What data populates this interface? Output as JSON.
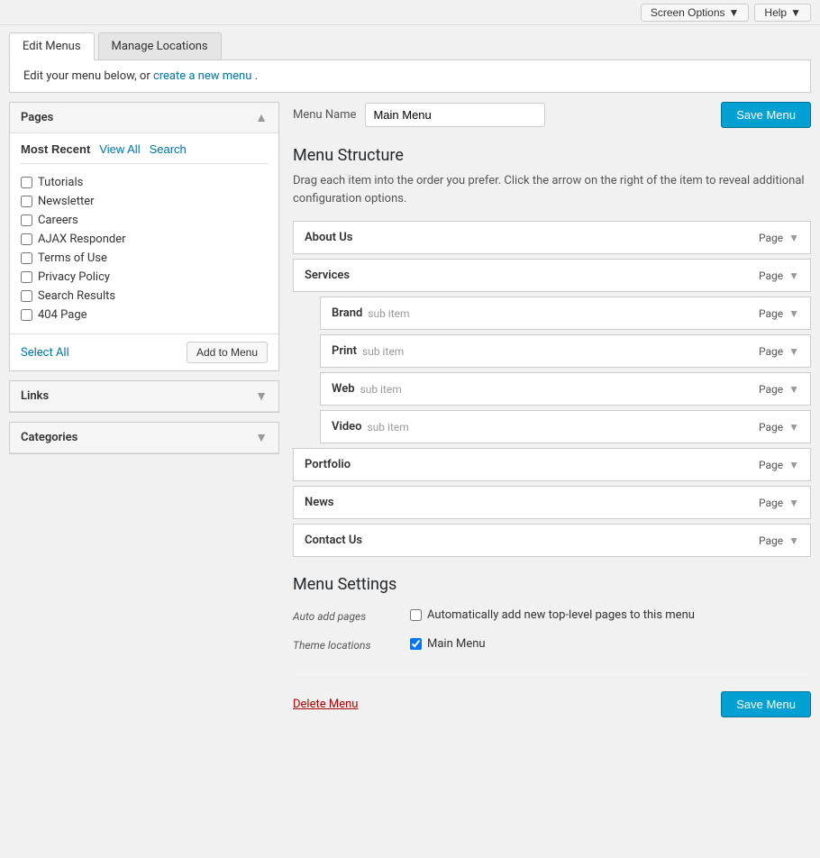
{
  "topbar": {
    "screen_options_label": "Screen Options",
    "help_label": "Help"
  },
  "tabs": [
    {
      "id": "edit-menus",
      "label": "Edit Menus",
      "active": true
    },
    {
      "id": "manage-locations",
      "label": "Manage Locations",
      "active": false
    }
  ],
  "notice": {
    "text": "Edit your menu below, or ",
    "link_text": "create a new menu",
    "text_after": "."
  },
  "left_panel": {
    "pages": {
      "title": "Pages",
      "sub_tabs": [
        {
          "id": "most-recent",
          "label": "Most Recent",
          "active": true
        },
        {
          "id": "view-all",
          "label": "View All",
          "active": false
        },
        {
          "id": "search",
          "label": "Search",
          "active": false
        }
      ],
      "items": [
        {
          "id": "tutorials",
          "label": "Tutorials",
          "checked": false
        },
        {
          "id": "newsletter",
          "label": "Newsletter",
          "checked": false
        },
        {
          "id": "careers",
          "label": "Careers",
          "checked": false
        },
        {
          "id": "ajax-responder",
          "label": "AJAX Responder",
          "checked": false
        },
        {
          "id": "terms-of-use",
          "label": "Terms of Use",
          "checked": false
        },
        {
          "id": "privacy-policy",
          "label": "Privacy Policy",
          "checked": false
        },
        {
          "id": "search-results",
          "label": "Search Results",
          "checked": false
        },
        {
          "id": "404-page",
          "label": "404 Page",
          "checked": false
        }
      ],
      "select_all_label": "Select All",
      "add_to_menu_label": "Add to Menu"
    },
    "links": {
      "title": "Links",
      "collapsed": true
    },
    "categories": {
      "title": "Categories",
      "collapsed": true
    }
  },
  "right_panel": {
    "menu_name_label": "Menu Name",
    "menu_name_value": "Main Menu",
    "save_menu_label": "Save Menu",
    "structure_title": "Menu Structure",
    "structure_desc": "Drag each item into the order you prefer. Click the arrow on the right of the item to reveal additional configuration options.",
    "menu_items": [
      {
        "id": "about-us",
        "label": "About Us",
        "sub_label": "",
        "type": "Page",
        "is_sub": false
      },
      {
        "id": "services",
        "label": "Services",
        "sub_label": "",
        "type": "Page",
        "is_sub": false
      },
      {
        "id": "brand",
        "label": "Brand",
        "sub_label": "sub item",
        "type": "Page",
        "is_sub": true
      },
      {
        "id": "print",
        "label": "Print",
        "sub_label": "sub item",
        "type": "Page",
        "is_sub": true
      },
      {
        "id": "web",
        "label": "Web",
        "sub_label": "sub item",
        "type": "Page",
        "is_sub": true
      },
      {
        "id": "video",
        "label": "Video",
        "sub_label": "sub item",
        "type": "Page",
        "is_sub": true
      },
      {
        "id": "portfolio",
        "label": "Portfolio",
        "sub_label": "",
        "type": "Page",
        "is_sub": false
      },
      {
        "id": "news",
        "label": "News",
        "sub_label": "",
        "type": "Page",
        "is_sub": false
      },
      {
        "id": "contact-us",
        "label": "Contact Us",
        "sub_label": "",
        "type": "Page",
        "is_sub": false
      }
    ],
    "settings": {
      "title": "Menu Settings",
      "auto_add_label": "Auto add pages",
      "auto_add_desc": "Automatically add new top-level pages to this menu",
      "auto_add_checked": false,
      "theme_locations_label": "Theme locations",
      "theme_locations_value": "Main Menu",
      "theme_locations_checked": true
    },
    "delete_menu_label": "Delete Menu",
    "save_menu_bottom_label": "Save Menu"
  }
}
